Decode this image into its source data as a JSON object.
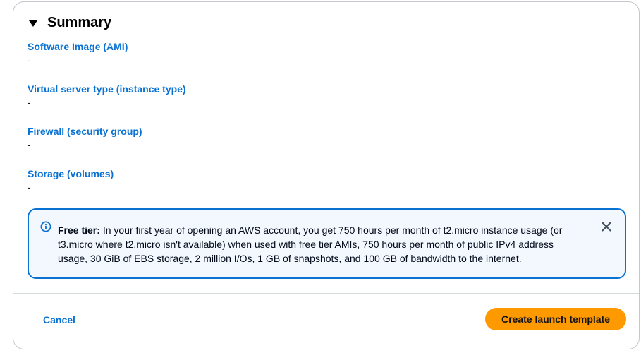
{
  "summary": {
    "title": "Summary",
    "fields": [
      {
        "label": "Software Image (AMI)",
        "value": "-"
      },
      {
        "label": "Virtual server type (instance type)",
        "value": "-"
      },
      {
        "label": "Firewall (security group)",
        "value": "-"
      },
      {
        "label": "Storage (volumes)",
        "value": "-"
      }
    ]
  },
  "alert": {
    "title": "Free tier:",
    "body": "In your first year of opening an AWS account, you get 750 hours per month of t2.micro instance usage (or t3.micro where t2.micro isn't available) when used with free tier AMIs, 750 hours per month of public IPv4 address usage, 30 GiB of EBS storage, 2 million I/Os, 1 GB of snapshots, and 100 GB of bandwidth to the internet.",
    "icon": "info-icon",
    "close_icon": "close-icon",
    "accent": "#0972d3",
    "background": "#f2f8fd"
  },
  "footer": {
    "cancel_label": "Cancel",
    "primary_label": "Create launch template",
    "primary_color": "#ff9900"
  }
}
